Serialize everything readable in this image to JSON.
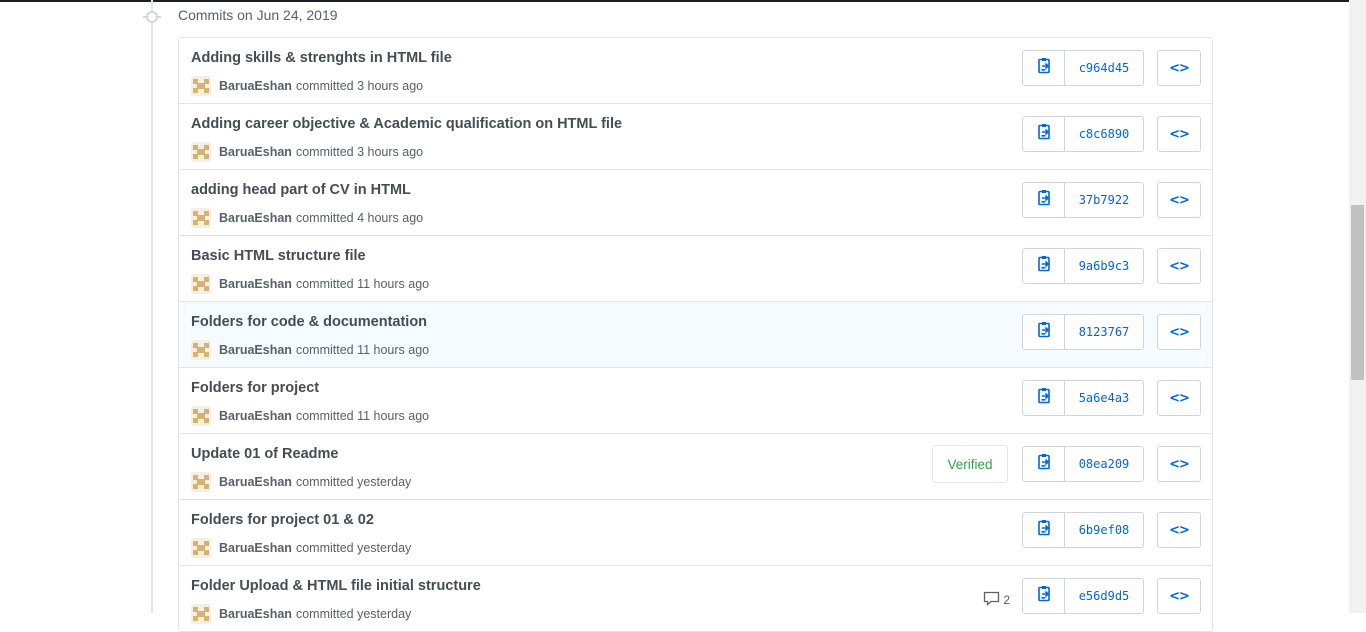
{
  "group": {
    "title": "Commits on Jun 24, 2019"
  },
  "commits": [
    {
      "message": "Adding skills & strenghts in HTML file",
      "author": "BaruaEshan",
      "committed": "committed 3 hours ago",
      "sha": "c964d45"
    },
    {
      "message": "Adding career objective & Academic qualification on HTML file",
      "author": "BaruaEshan",
      "committed": "committed 3 hours ago",
      "sha": "c8c6890"
    },
    {
      "message": "adding head part of CV in HTML",
      "author": "BaruaEshan",
      "committed": "committed 4 hours ago",
      "sha": "37b7922"
    },
    {
      "message": "Basic HTML structure file",
      "author": "BaruaEshan",
      "committed": "committed 11 hours ago",
      "sha": "9a6b9c3"
    },
    {
      "message": "Folders for code & documentation",
      "author": "BaruaEshan",
      "committed": "committed 11 hours ago",
      "sha": "8123767"
    },
    {
      "message": "Folders for project",
      "author": "BaruaEshan",
      "committed": "committed 11 hours ago",
      "sha": "5a6e4a3"
    },
    {
      "message": "Update 01 of Readme",
      "author": "BaruaEshan",
      "committed": "committed yesterday",
      "sha": "08ea209",
      "badge": "Verified"
    },
    {
      "message": "Folders for project 01 & 02",
      "author": "BaruaEshan",
      "committed": "committed yesterday",
      "sha": "6b9ef08"
    },
    {
      "message": "Folder Upload & HTML file initial structure",
      "author": "BaruaEshan",
      "committed": "committed yesterday",
      "sha": "e56d9d5",
      "comment_count": "2"
    }
  ],
  "icons": {
    "copy": "clippy-icon",
    "browse": "code-icon",
    "comment": "comment-icon",
    "timeline": "git-commit-icon"
  },
  "colors": {
    "link": "#0366d6",
    "verified": "#28a745",
    "highlight_row": "#f6fbff",
    "border": "#e1e4e8"
  }
}
